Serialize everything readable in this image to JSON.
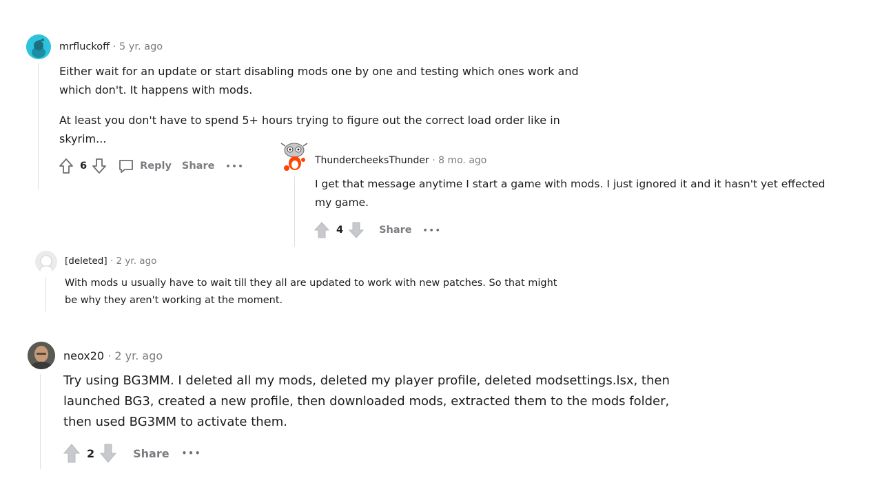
{
  "comments": [
    {
      "author": "mrfluckoff",
      "separator": "·",
      "time": "5 yr. ago",
      "paragraphs": [
        "Either wait for an update or start disabling mods one by one and testing which ones work and",
        "which don't. It happens with mods.",
        "At least you don't have to spend 5+ hours trying to figure out the correct load order like in",
        "skyrim..."
      ],
      "votes": "6",
      "reply_label": "Reply",
      "share_label": "Share",
      "more_label": "•••",
      "avatar_color": "#2ec3dd"
    },
    {
      "author": "ThundercheeksThunder",
      "separator": "·",
      "time": "8 mo. ago",
      "paragraphs": [
        "I get that message anytime I start a game with mods. I just ignored it and it hasn't yet effected",
        "my game."
      ],
      "votes": "4",
      "share_label": "Share",
      "more_label": "•••"
    },
    {
      "author": "[deleted]",
      "separator": "·",
      "time": "2 yr. ago",
      "paragraphs": [
        "With mods u usually have to wait till they all are updated to work with new patches. So that might",
        "be why they aren't working at the moment."
      ]
    },
    {
      "author": "neox20",
      "separator": "·",
      "time": "2 yr. ago",
      "paragraphs": [
        "Try using BG3MM. I deleted all my mods, deleted my player profile, deleted modsettings.lsx, then",
        "launched BG3, created a new profile, then downloaded mods, extracted them to the mods folder,",
        "then used BG3MM to activate them."
      ],
      "votes": "2",
      "share_label": "Share",
      "more_label": "•••"
    }
  ],
  "colors": {
    "thread_line": "#dcdfe2",
    "meta_gray": "#7c7c7c",
    "action_gray": "#7a7d80"
  },
  "icons": [
    "upvote-icon",
    "downvote-icon",
    "comment-icon",
    "more-icon",
    "avatar-icon"
  ]
}
